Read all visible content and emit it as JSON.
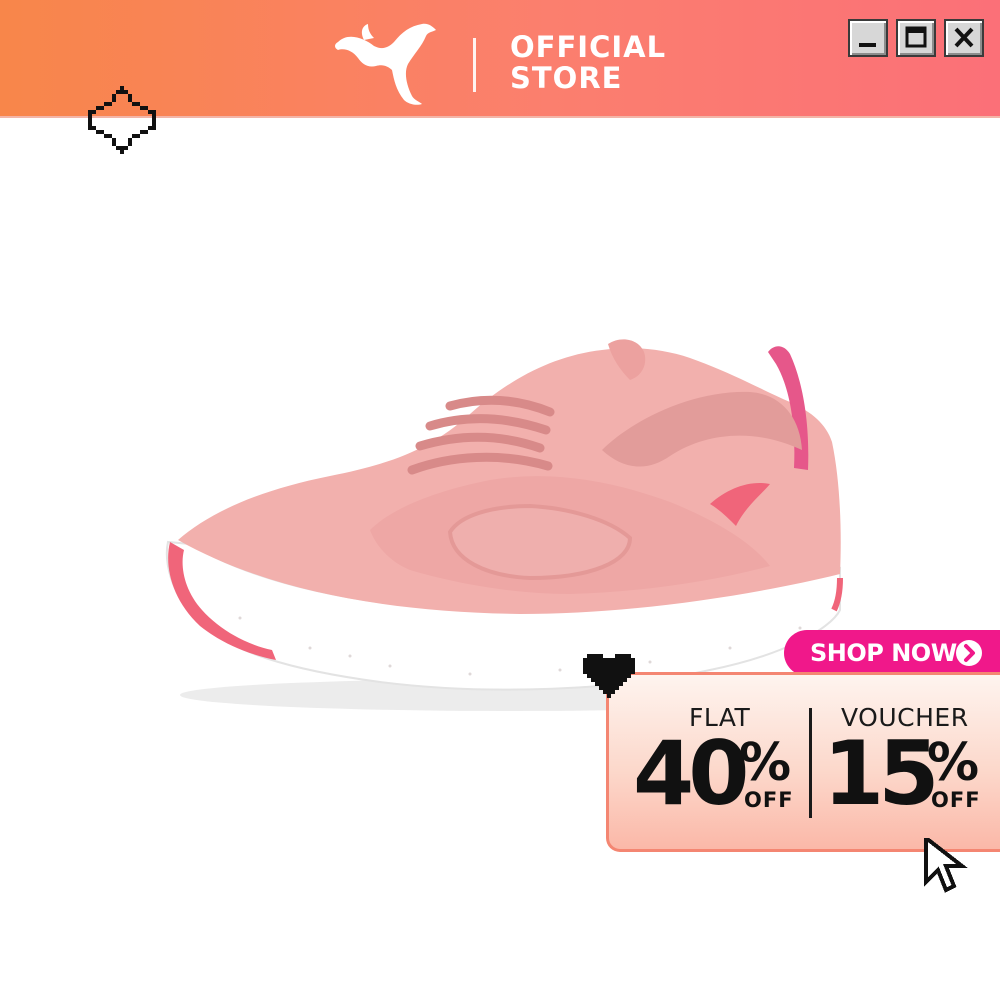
{
  "header": {
    "brand_logo": "puma-cat-logo",
    "store_label_line1": "OFFICIAL",
    "store_label_line2": "STORE",
    "window_controls": [
      "minimize",
      "maximize",
      "close"
    ],
    "colors": {
      "gradient_start": "#f8864a",
      "gradient_end": "#fb7078"
    }
  },
  "product": {
    "image": "pink-running-sneaker",
    "colors": {
      "upper": "#f2b0ad",
      "sole": "#ffffff",
      "accent": "#f0657a"
    }
  },
  "decorations": {
    "sparkle": "pixel-sparkle-icon",
    "heart": "pixel-heart-icon",
    "cursor": "pixel-cursor-icon"
  },
  "cta": {
    "label": "SHOP NOW",
    "icon": "chevron-right-icon",
    "color": "#f0188a"
  },
  "promo": {
    "left": {
      "caption": "FLAT",
      "value": "40",
      "percent": "%",
      "suffix": "OFF"
    },
    "right": {
      "caption": "VOUCHER",
      "value": "15",
      "percent": "%",
      "suffix": "OFF"
    },
    "colors": {
      "border": "#f48672",
      "bg_top": "#fef4ef",
      "bg_bottom": "#fbb8a8"
    }
  }
}
